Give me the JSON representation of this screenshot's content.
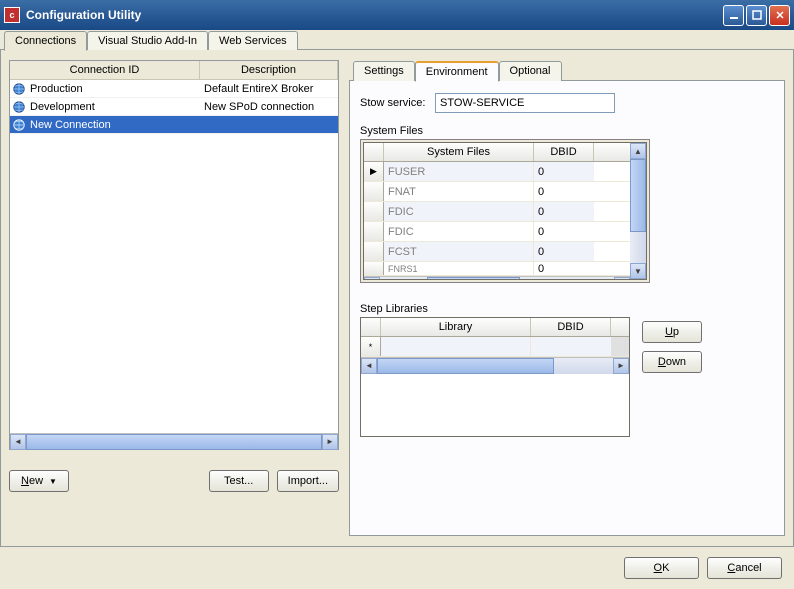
{
  "window": {
    "title": "Configuration Utility"
  },
  "main_tabs": {
    "t1": "Connections",
    "t2": "Visual Studio Add-In",
    "t3": "Web Services",
    "active": 0
  },
  "conn_table": {
    "h1": "Connection ID",
    "h2": "Description",
    "rows": [
      {
        "name": "Production",
        "desc": "Default EntireX Broker"
      },
      {
        "name": "Development",
        "desc": "New SPoD connection"
      },
      {
        "name": "New Connection",
        "desc": ""
      }
    ],
    "selected": 2
  },
  "left_buttons": {
    "new": "New",
    "test": "Test...",
    "import": "Import..."
  },
  "sub_tabs": {
    "t1": "Settings",
    "t2": "Environment",
    "t3": "Optional",
    "active": 1
  },
  "stow": {
    "label": "Stow service:",
    "value": "STOW-SERVICE"
  },
  "system_files": {
    "label": "System Files",
    "h1": "System Files",
    "h2": "DBID",
    "rows": [
      {
        "name": "FUSER",
        "dbid": "0"
      },
      {
        "name": "FNAT",
        "dbid": "0"
      },
      {
        "name": "FDIC",
        "dbid": "0"
      },
      {
        "name": "FDIC",
        "dbid": "0"
      },
      {
        "name": "FCST",
        "dbid": "0"
      },
      {
        "name": "FNRS1",
        "dbid": "0"
      }
    ]
  },
  "step_lib": {
    "label": "Step Libraries",
    "h1": "Library",
    "h2": "DBID",
    "rows": [
      {
        "lib": "",
        "dbid": ""
      }
    ]
  },
  "buttons": {
    "up": "Up",
    "down": "Down",
    "ok": "OK",
    "cancel": "Cancel"
  }
}
